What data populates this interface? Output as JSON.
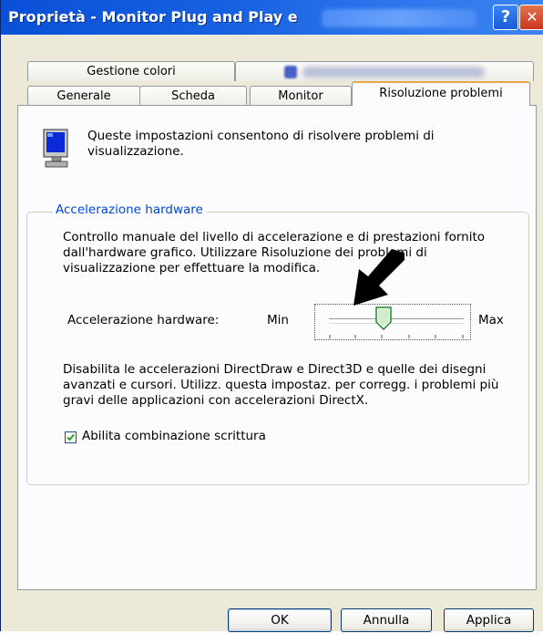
{
  "window": {
    "title": "Proprietà - Monitor Plug and Play e",
    "help_glyph": "?",
    "close_glyph": "✕"
  },
  "tabs": {
    "row1": [
      "Gestione colori",
      ""
    ],
    "row2": [
      "Generale",
      "Scheda",
      "Monitor",
      "Risoluzione problemi"
    ],
    "active": "Risoluzione problemi"
  },
  "panel": {
    "intro_text": "Queste impostazioni consentono di risolvere problemi di visualizzazione.",
    "group_title": "Accelerazione hardware",
    "description": "Controllo manuale del livello di accelerazione e di prestazioni fornito dall'hardware grafico. Utilizzare Risoluzione dei problemi di visualizzazione per effettuare la modifica.",
    "slider": {
      "label": "Accelerazione hardware:",
      "min_label": "Min",
      "max_label": "Max",
      "position_fraction": 0.4
    },
    "description2": "Disabilita le accelerazioni DirectDraw e Direct3D e quelle dei disegni avanzati e cursori. Utilizz. questa impostaz. per corregg. i problemi più gravi delle applicazioni con accelerazioni DirectX.",
    "checkbox": {
      "label": "Abilita combinazione scrittura",
      "checked": true
    }
  },
  "buttons": {
    "ok": "OK",
    "cancel": "Annulla",
    "apply": "Applica"
  },
  "colors": {
    "titlebar": "#0a50d8",
    "active_tab_accent": "#e8a64a",
    "group_title": "#0046d5",
    "dialog_bg": "#ece9d8"
  }
}
